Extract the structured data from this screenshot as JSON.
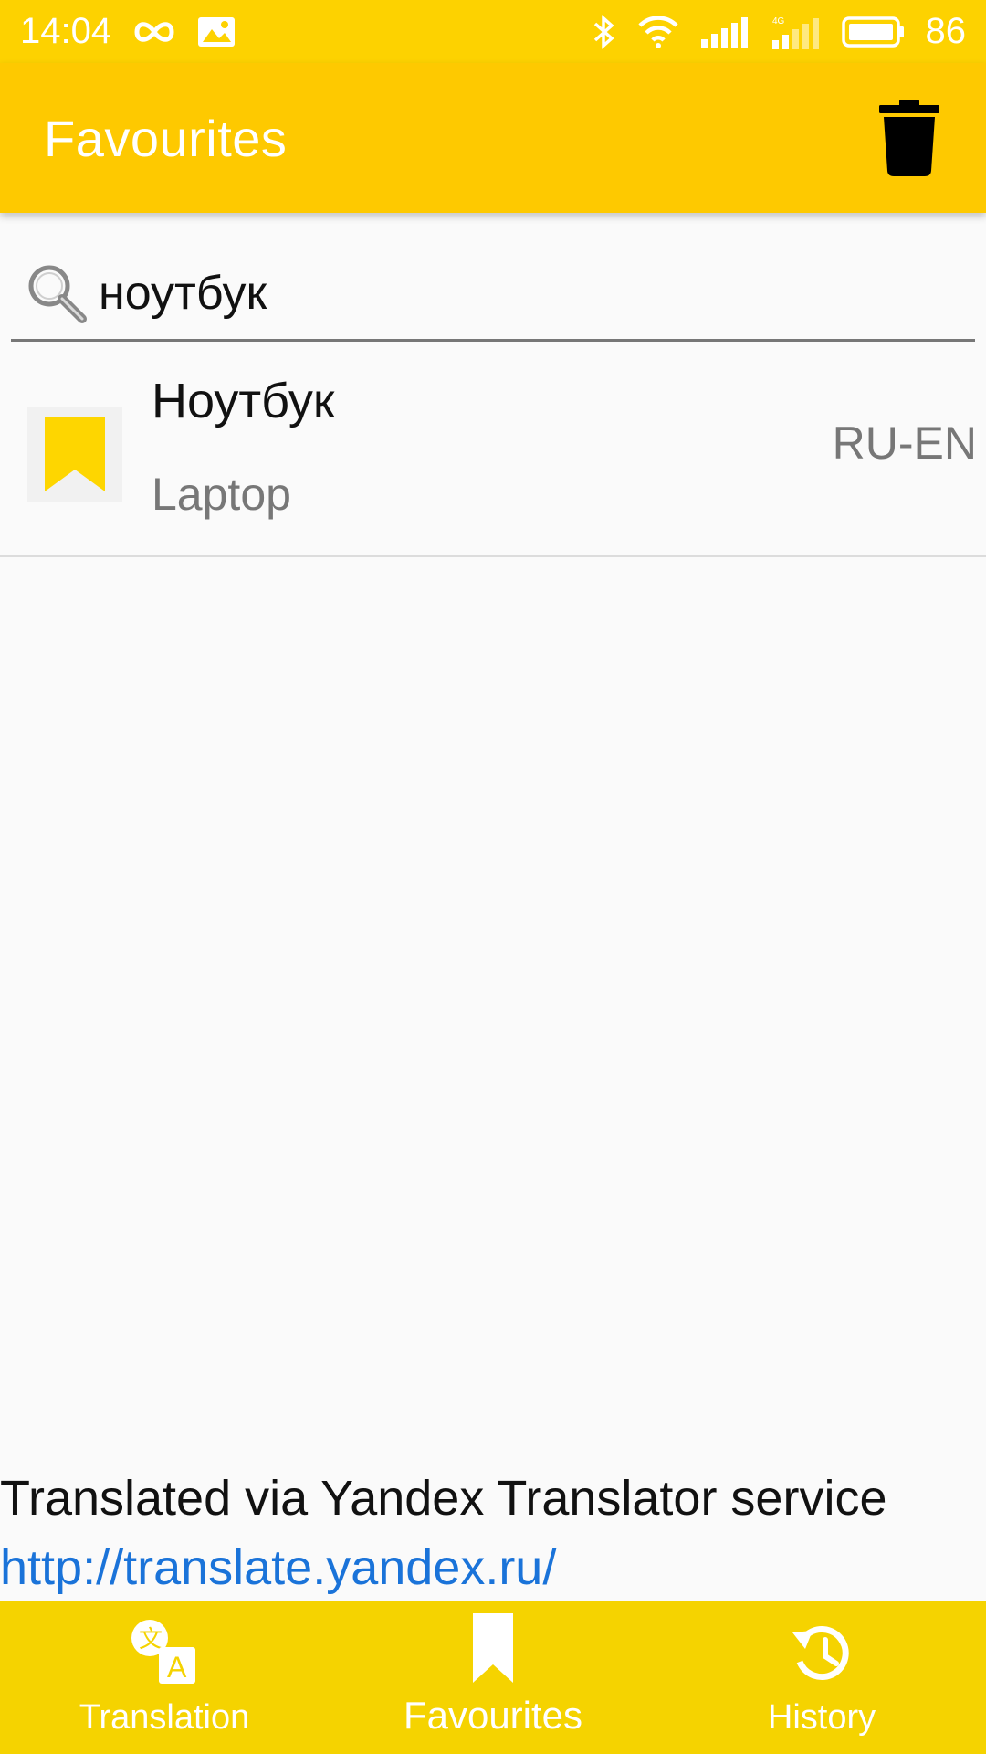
{
  "status_bar": {
    "time": "14:04",
    "battery": "86",
    "icons": [
      "infinity-icon",
      "image-notification-icon",
      "bluetooth-icon",
      "wifi-icon",
      "signal-icon",
      "signal-4g-icon",
      "battery-icon"
    ]
  },
  "app_bar": {
    "title": "Favourites",
    "actions": [
      "trash-icon"
    ]
  },
  "search": {
    "value": "ноутбук",
    "icon": "search-icon"
  },
  "favourites": [
    {
      "word": "Ноутбук",
      "translation": "Laptop",
      "lang": "RU-EN",
      "icon": "bookmark-icon"
    }
  ],
  "attribution": {
    "text": "Translated via Yandex Translator service",
    "link": "http://translate.yandex.ru/"
  },
  "bottom_nav": {
    "items": [
      {
        "label": "Translation",
        "icon": "translate-icon",
        "active": false
      },
      {
        "label": "Favourites",
        "icon": "bookmark-icon",
        "active": true
      },
      {
        "label": "History",
        "icon": "history-icon",
        "active": false
      }
    ]
  },
  "colors": {
    "status_bar": "#fdd200",
    "app_bar": "#fec900",
    "bottom_nav": "#f5d300",
    "accent": "#fed600",
    "link": "#1a73d9"
  }
}
